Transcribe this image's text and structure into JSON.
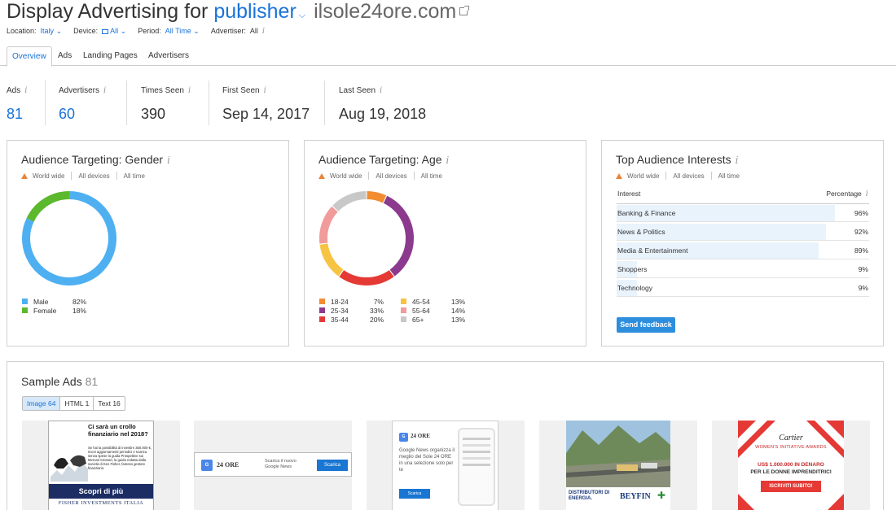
{
  "header": {
    "title": "Display Advertising for",
    "publisher": "publisher",
    "domain": "ilsole24ore.com"
  },
  "filters": {
    "location_label": "Location:",
    "location_value": "Italy",
    "device_label": "Device:",
    "device_value": "All",
    "period_label": "Period:",
    "period_value": "All Time",
    "advertiser_label": "Advertiser:",
    "advertiser_value": "All"
  },
  "tabs": [
    {
      "label": "Overview"
    },
    {
      "label": "Ads"
    },
    {
      "label": "Landing Pages"
    },
    {
      "label": "Advertisers"
    }
  ],
  "stats": [
    {
      "label": "Ads",
      "value": "81"
    },
    {
      "label": "Advertisers",
      "value": "60"
    },
    {
      "label": "Times Seen",
      "value": "390"
    },
    {
      "label": "First Seen",
      "value": "Sep 14, 2017"
    },
    {
      "label": "Last Seen",
      "value": "Aug 19, 2018"
    }
  ],
  "scope": {
    "region": "World wide",
    "devices": "All devices",
    "time": "All time"
  },
  "gender": {
    "title": "Audience Targeting: Gender",
    "items": [
      {
        "name": "Male",
        "pct": "82%",
        "value": 82,
        "color": "#4eb0f1"
      },
      {
        "name": "Female",
        "pct": "18%",
        "value": 18,
        "color": "#5cb82c"
      }
    ]
  },
  "age": {
    "title": "Audience Targeting: Age",
    "items": [
      {
        "name": "18-24",
        "pct": "7%",
        "value": 7,
        "color": "#f28c30"
      },
      {
        "name": "25-34",
        "pct": "33%",
        "value": 33,
        "color": "#8b3a8e"
      },
      {
        "name": "35-44",
        "pct": "20%",
        "value": 20,
        "color": "#e53935"
      },
      {
        "name": "45-54",
        "pct": "13%",
        "value": 13,
        "color": "#f6c342"
      },
      {
        "name": "55-64",
        "pct": "14%",
        "value": 14,
        "color": "#f29b9b"
      },
      {
        "name": "65+",
        "pct": "13%",
        "value": 13,
        "color": "#c8c8c8"
      }
    ]
  },
  "interests": {
    "title": "Top Audience Interests",
    "col_interest": "Interest",
    "col_percentage": "Percentage",
    "rows": [
      {
        "name": "Banking & Finance",
        "pct": "96%",
        "value": 96
      },
      {
        "name": "News & Politics",
        "pct": "92%",
        "value": 92
      },
      {
        "name": "Media & Entertainment",
        "pct": "89%",
        "value": 89
      },
      {
        "name": "Shoppers",
        "pct": "9%",
        "value": 9
      },
      {
        "name": "Technology",
        "pct": "9%",
        "value": 9
      }
    ],
    "feedback_button": "Send feedback"
  },
  "samples": {
    "title": "Sample Ads",
    "count": "81",
    "seg": [
      {
        "label": "Image 64"
      },
      {
        "label": "HTML 1"
      },
      {
        "label": "Text 16"
      }
    ],
    "ad1": {
      "headline": "Ci sarà un crollo finanziario nel 2018?",
      "body": "Se hai la possibilità di investire 350.000 €, ricevi aggiornamenti periodici e scarica senza spese la guida Prospettive sui Mercati Azionari, la guida redatta dalla società di Ken Fisher, famoso gestore finanziario.",
      "cta": "Scopri di più",
      "brand": "Fisher Investments Italia"
    },
    "ad2": {
      "logo": "24 ORE",
      "text": "Scarica il nuovo Google News",
      "cta": "Scarica"
    },
    "ad3": {
      "logo": "24 ORE",
      "text": "Google News organizza il meglio del Sole 24 ORE in una selezione solo per te",
      "cta": "Scarica"
    },
    "ad4": {
      "caption": "DISTRIBUTORI DI ENERGIA.",
      "brand": "BEYFIN"
    },
    "ad5": {
      "brand": "Cartier",
      "line1": "WOMEN'S INITIATIVE AWARDS",
      "line2": "US$ 1.000.000 IN DENARO",
      "line3": "PER LE DONNE IMPRENDITRICI",
      "cta": "ISCRIVITI SUBITO!"
    }
  }
}
